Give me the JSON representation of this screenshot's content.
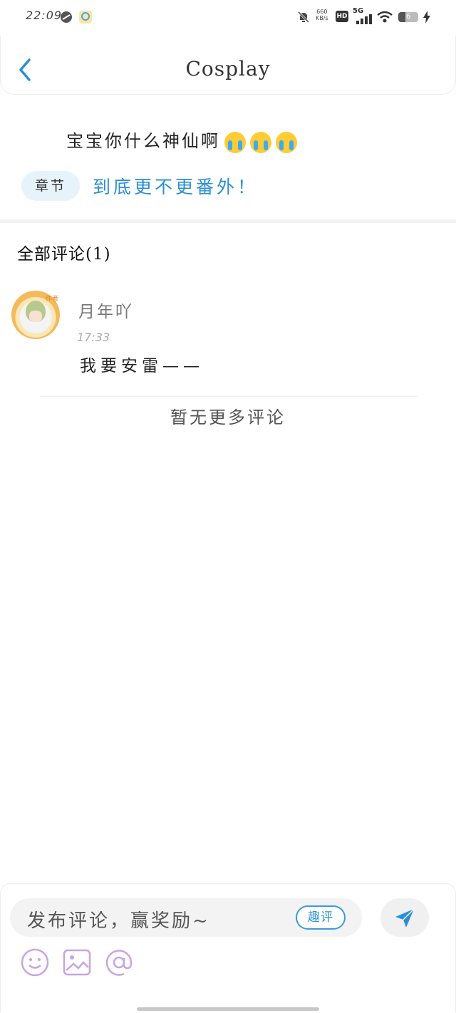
{
  "status_bar": {
    "time": "22:09",
    "net_speed_value": "660",
    "net_speed_unit": "KB/s",
    "hd_label": "HD",
    "network": "5G",
    "battery_level": "6"
  },
  "header": {
    "title": "Cosplay",
    "back_icon": "chevron-left-icon"
  },
  "post": {
    "text": "宝宝你什么神仙啊",
    "emoji": "loudly-crying-face-icon",
    "emoji_count": 3,
    "chapter_tag": "章节",
    "chapter_title": "到底更不更番外！"
  },
  "comments_section": {
    "heading": "全部评论(1)",
    "comments": [
      {
        "username": "月年吖",
        "time": "17:33",
        "text": "我要安雷——",
        "avatar_badge": "作者"
      }
    ],
    "no_more_text": "暂无更多评论"
  },
  "input_bar": {
    "placeholder": "发布评论，赢奖励~",
    "quping_label": "趣评",
    "send_icon": "send-icon",
    "tools": [
      "emoji-icon",
      "image-icon",
      "mention-icon"
    ]
  },
  "colors": {
    "accent": "#2a8fd6",
    "tag_bg": "#e6f3fb",
    "tool_icon": "#c9a3e6"
  }
}
